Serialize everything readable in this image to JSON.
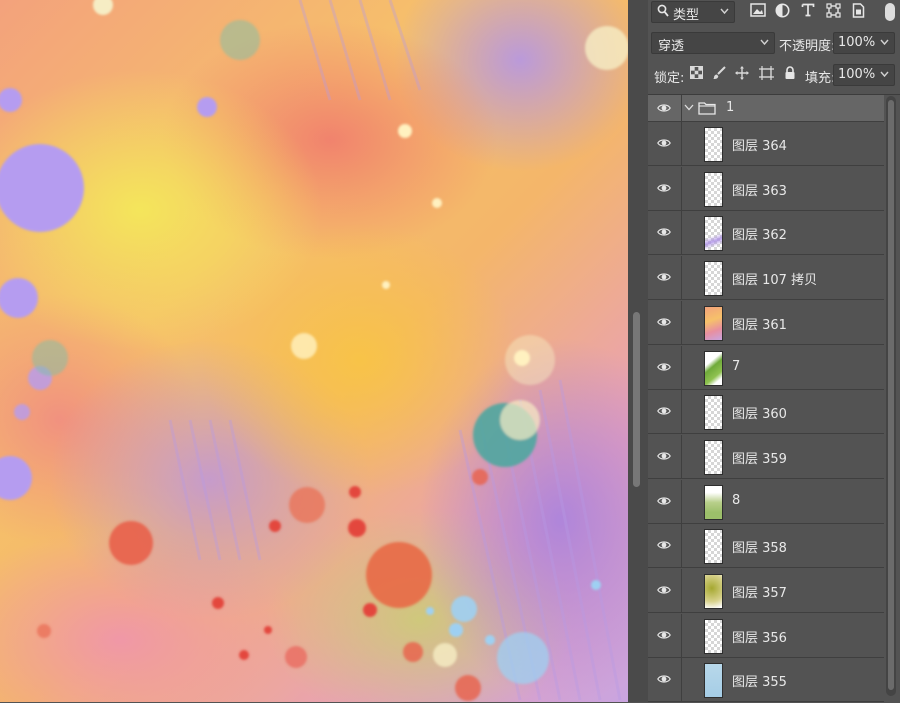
{
  "toolbar": {
    "filter_kind": "类型",
    "filter_icons": [
      "image-filter-icon",
      "adjustment-filter-icon",
      "type-filter-icon",
      "shape-filter-icon",
      "smart-object-filter-icon"
    ]
  },
  "blend": {
    "mode": "穿透",
    "opacity_label": "不透明度:",
    "opacity_value": "100%"
  },
  "lock": {
    "label": "锁定:",
    "fill_label": "填充:",
    "fill_value": "100%"
  },
  "layers": {
    "group_name": "1",
    "items": [
      {
        "name": "图层 364",
        "thumb": "transparent"
      },
      {
        "name": "图层 363",
        "thumb": "transparent"
      },
      {
        "name": "图层 362",
        "thumb": "transparent-purple"
      },
      {
        "name": "图层 107 拷贝",
        "thumb": "transparent"
      },
      {
        "name": "图层 361",
        "thumb": "colorful"
      },
      {
        "name": "7",
        "thumb": "green-leaf"
      },
      {
        "name": "图层 360",
        "thumb": "transparent"
      },
      {
        "name": "图层 359",
        "thumb": "transparent"
      },
      {
        "name": "8",
        "thumb": "green-wash"
      },
      {
        "name": "图层 358",
        "thumb": "transparent"
      },
      {
        "name": "图层 357",
        "thumb": "olive-wash"
      },
      {
        "name": "图层 356",
        "thumb": "transparent"
      },
      {
        "name": "图层 355",
        "thumb": "blue-wash"
      }
    ]
  },
  "colors": {
    "panel_bg": "#535353",
    "row_border": "#3f3f3f",
    "group_row": "#666666"
  }
}
